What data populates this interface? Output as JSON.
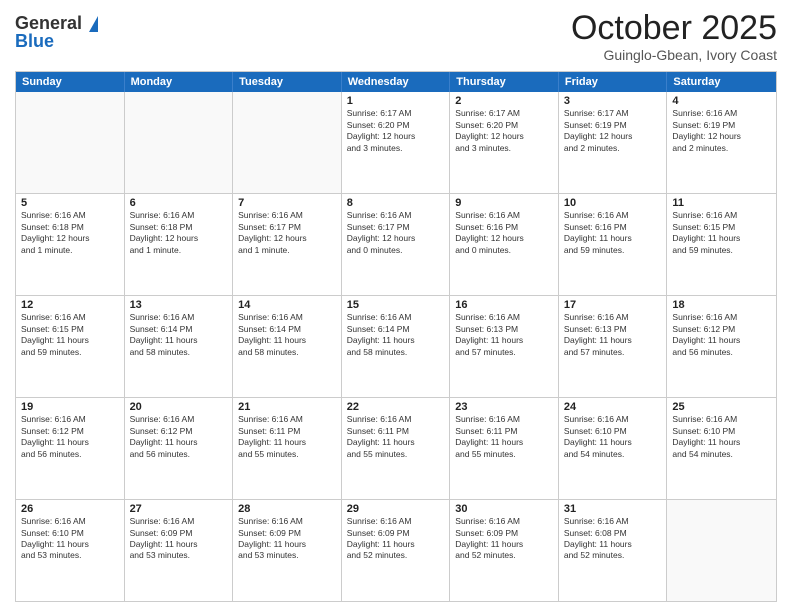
{
  "header": {
    "logo_general": "General",
    "logo_blue": "Blue",
    "month_title": "October 2025",
    "location": "Guinglo-Gbean, Ivory Coast"
  },
  "day_headers": [
    "Sunday",
    "Monday",
    "Tuesday",
    "Wednesday",
    "Thursday",
    "Friday",
    "Saturday"
  ],
  "weeks": [
    [
      {
        "day": "",
        "info": "",
        "empty": true
      },
      {
        "day": "",
        "info": "",
        "empty": true
      },
      {
        "day": "",
        "info": "",
        "empty": true
      },
      {
        "day": "1",
        "info": "Sunrise: 6:17 AM\nSunset: 6:20 PM\nDaylight: 12 hours\nand 3 minutes.",
        "empty": false
      },
      {
        "day": "2",
        "info": "Sunrise: 6:17 AM\nSunset: 6:20 PM\nDaylight: 12 hours\nand 3 minutes.",
        "empty": false
      },
      {
        "day": "3",
        "info": "Sunrise: 6:17 AM\nSunset: 6:19 PM\nDaylight: 12 hours\nand 2 minutes.",
        "empty": false
      },
      {
        "day": "4",
        "info": "Sunrise: 6:16 AM\nSunset: 6:19 PM\nDaylight: 12 hours\nand 2 minutes.",
        "empty": false
      }
    ],
    [
      {
        "day": "5",
        "info": "Sunrise: 6:16 AM\nSunset: 6:18 PM\nDaylight: 12 hours\nand 1 minute.",
        "empty": false
      },
      {
        "day": "6",
        "info": "Sunrise: 6:16 AM\nSunset: 6:18 PM\nDaylight: 12 hours\nand 1 minute.",
        "empty": false
      },
      {
        "day": "7",
        "info": "Sunrise: 6:16 AM\nSunset: 6:17 PM\nDaylight: 12 hours\nand 1 minute.",
        "empty": false
      },
      {
        "day": "8",
        "info": "Sunrise: 6:16 AM\nSunset: 6:17 PM\nDaylight: 12 hours\nand 0 minutes.",
        "empty": false
      },
      {
        "day": "9",
        "info": "Sunrise: 6:16 AM\nSunset: 6:16 PM\nDaylight: 12 hours\nand 0 minutes.",
        "empty": false
      },
      {
        "day": "10",
        "info": "Sunrise: 6:16 AM\nSunset: 6:16 PM\nDaylight: 11 hours\nand 59 minutes.",
        "empty": false
      },
      {
        "day": "11",
        "info": "Sunrise: 6:16 AM\nSunset: 6:15 PM\nDaylight: 11 hours\nand 59 minutes.",
        "empty": false
      }
    ],
    [
      {
        "day": "12",
        "info": "Sunrise: 6:16 AM\nSunset: 6:15 PM\nDaylight: 11 hours\nand 59 minutes.",
        "empty": false
      },
      {
        "day": "13",
        "info": "Sunrise: 6:16 AM\nSunset: 6:14 PM\nDaylight: 11 hours\nand 58 minutes.",
        "empty": false
      },
      {
        "day": "14",
        "info": "Sunrise: 6:16 AM\nSunset: 6:14 PM\nDaylight: 11 hours\nand 58 minutes.",
        "empty": false
      },
      {
        "day": "15",
        "info": "Sunrise: 6:16 AM\nSunset: 6:14 PM\nDaylight: 11 hours\nand 58 minutes.",
        "empty": false
      },
      {
        "day": "16",
        "info": "Sunrise: 6:16 AM\nSunset: 6:13 PM\nDaylight: 11 hours\nand 57 minutes.",
        "empty": false
      },
      {
        "day": "17",
        "info": "Sunrise: 6:16 AM\nSunset: 6:13 PM\nDaylight: 11 hours\nand 57 minutes.",
        "empty": false
      },
      {
        "day": "18",
        "info": "Sunrise: 6:16 AM\nSunset: 6:12 PM\nDaylight: 11 hours\nand 56 minutes.",
        "empty": false
      }
    ],
    [
      {
        "day": "19",
        "info": "Sunrise: 6:16 AM\nSunset: 6:12 PM\nDaylight: 11 hours\nand 56 minutes.",
        "empty": false
      },
      {
        "day": "20",
        "info": "Sunrise: 6:16 AM\nSunset: 6:12 PM\nDaylight: 11 hours\nand 56 minutes.",
        "empty": false
      },
      {
        "day": "21",
        "info": "Sunrise: 6:16 AM\nSunset: 6:11 PM\nDaylight: 11 hours\nand 55 minutes.",
        "empty": false
      },
      {
        "day": "22",
        "info": "Sunrise: 6:16 AM\nSunset: 6:11 PM\nDaylight: 11 hours\nand 55 minutes.",
        "empty": false
      },
      {
        "day": "23",
        "info": "Sunrise: 6:16 AM\nSunset: 6:11 PM\nDaylight: 11 hours\nand 55 minutes.",
        "empty": false
      },
      {
        "day": "24",
        "info": "Sunrise: 6:16 AM\nSunset: 6:10 PM\nDaylight: 11 hours\nand 54 minutes.",
        "empty": false
      },
      {
        "day": "25",
        "info": "Sunrise: 6:16 AM\nSunset: 6:10 PM\nDaylight: 11 hours\nand 54 minutes.",
        "empty": false
      }
    ],
    [
      {
        "day": "26",
        "info": "Sunrise: 6:16 AM\nSunset: 6:10 PM\nDaylight: 11 hours\nand 53 minutes.",
        "empty": false
      },
      {
        "day": "27",
        "info": "Sunrise: 6:16 AM\nSunset: 6:09 PM\nDaylight: 11 hours\nand 53 minutes.",
        "empty": false
      },
      {
        "day": "28",
        "info": "Sunrise: 6:16 AM\nSunset: 6:09 PM\nDaylight: 11 hours\nand 53 minutes.",
        "empty": false
      },
      {
        "day": "29",
        "info": "Sunrise: 6:16 AM\nSunset: 6:09 PM\nDaylight: 11 hours\nand 52 minutes.",
        "empty": false
      },
      {
        "day": "30",
        "info": "Sunrise: 6:16 AM\nSunset: 6:09 PM\nDaylight: 11 hours\nand 52 minutes.",
        "empty": false
      },
      {
        "day": "31",
        "info": "Sunrise: 6:16 AM\nSunset: 6:08 PM\nDaylight: 11 hours\nand 52 minutes.",
        "empty": false
      },
      {
        "day": "",
        "info": "",
        "empty": true
      }
    ]
  ]
}
